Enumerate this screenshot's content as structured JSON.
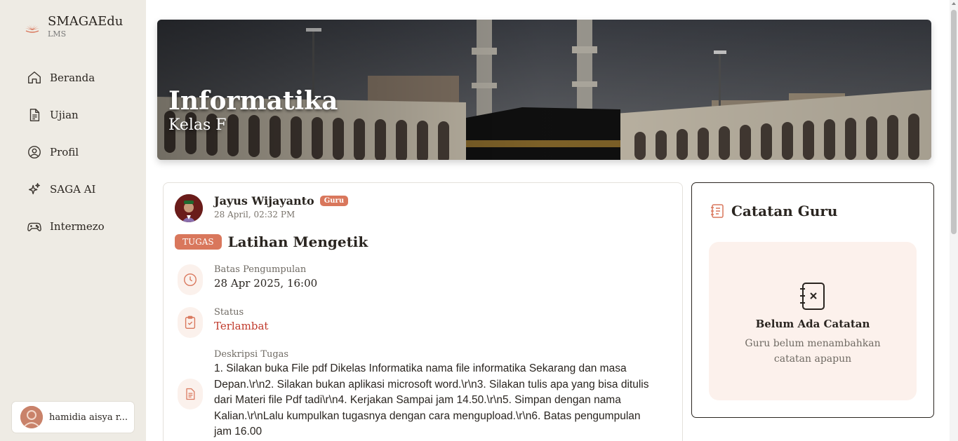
{
  "brand": {
    "name": "SMAGAEdu",
    "sub": "LMS"
  },
  "sidebar": {
    "items": [
      {
        "label": "Beranda",
        "icon": "home-icon"
      },
      {
        "label": "Ujian",
        "icon": "document-icon"
      },
      {
        "label": "Profil",
        "icon": "user-circle-icon"
      },
      {
        "label": "SAGA AI",
        "icon": "sparkles-icon"
      },
      {
        "label": "Intermezo",
        "icon": "gamepad-icon"
      }
    ]
  },
  "user": {
    "name": "hamidia aisya r..."
  },
  "banner": {
    "title": "Informatika",
    "subtitle": "Kelas F"
  },
  "post": {
    "author": "Jayus Wijayanto",
    "role_badge": "Guru",
    "date": "28 April, 02:32 PM",
    "type_badge": "TUGAS",
    "title": "Latihan Mengetik",
    "deadline_label": "Batas Pengumpulan",
    "deadline_value": "28 Apr 2025, 16:00",
    "status_label": "Status",
    "status_value": "Terlambat",
    "status_color": "#c0392b",
    "desc_label": "Deskripsi Tugas",
    "desc_value": "1. Silakan buka File pdf Dikelas Informatika nama file informatika Sekarang dan masa Depan.\\r\\n2. Silakan bukan aplikasi microsoft word.\\r\\n3. Silakan tulis apa yang bisa ditulis dari Materi file Pdf tadi\\r\\n4. Kerjakan Sampai jam 14.50.\\r\\n5. Simpan dengan nama Kalian.\\r\\nLalu kumpulkan tugasnya dengan cara mengupload.\\r\\n6. Batas pengumpulan jam 16.00"
  },
  "notes": {
    "title": "Catatan Guru",
    "empty_title": "Belum Ada Catatan",
    "empty_sub": "Guru belum menambahkan catatan apapun"
  },
  "colors": {
    "accent": "#d9775c",
    "sidebar_bg": "#eeebe4",
    "late": "#c0392b"
  }
}
